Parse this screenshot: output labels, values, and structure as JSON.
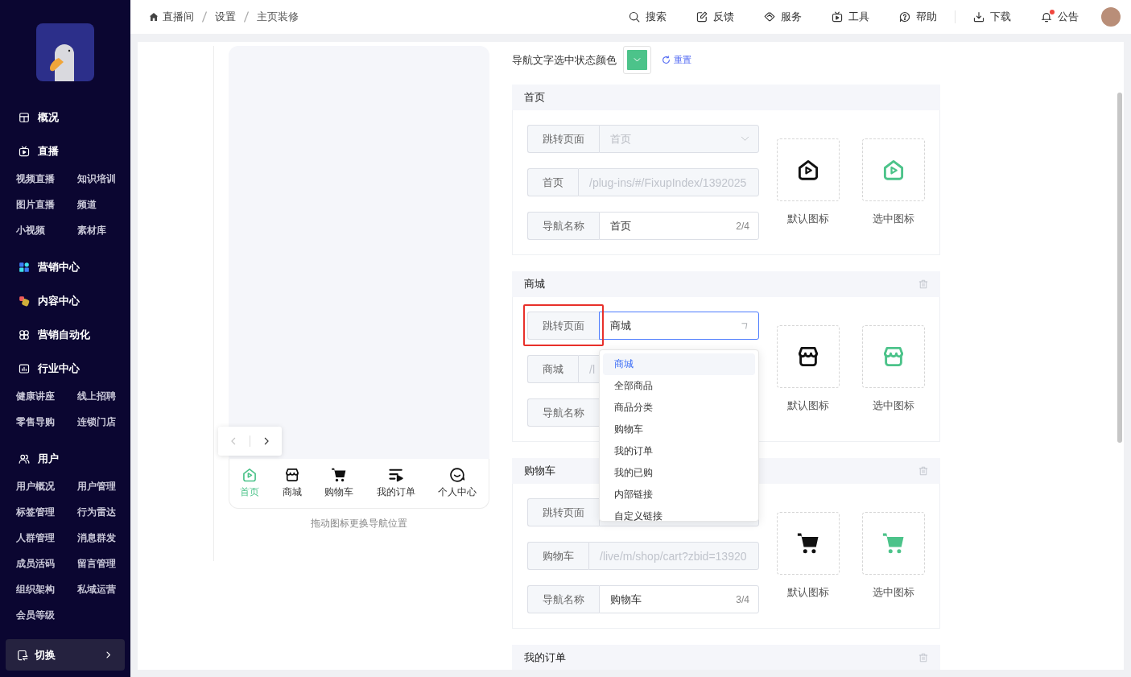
{
  "sidebar": {
    "sections": [
      {
        "label": "概况"
      },
      {
        "label": "直播",
        "items": [
          "视频直播",
          "知识培训",
          "图片直播",
          "频道",
          "小视频",
          "素材库"
        ]
      },
      {
        "label": "营销中心"
      },
      {
        "label": "内容中心"
      },
      {
        "label": "营销自动化"
      },
      {
        "label": "行业中心",
        "items": [
          "健康讲座",
          "线上招聘",
          "零售导购",
          "连锁门店"
        ]
      },
      {
        "label": "用户",
        "items": [
          "用户概况",
          "用户管理",
          "标签管理",
          "行为雷达",
          "人群管理",
          "消息群发",
          "成员活码",
          "留言管理",
          "组织架构",
          "私域运营",
          "会员等级"
        ]
      }
    ],
    "switch_button": {
      "label": "切换"
    }
  },
  "topbar": {
    "breadcrumb": [
      "直播间",
      "设置",
      "主页装修"
    ],
    "action_groups": [
      {
        "actions": [
          {
            "label": "搜索",
            "badge": false
          },
          {
            "label": "反馈",
            "badge": false
          },
          {
            "label": "服务",
            "badge": false
          },
          {
            "label": "工具",
            "badge": false
          },
          {
            "label": "帮助",
            "badge": false
          }
        ]
      },
      {
        "actions": [
          {
            "label": "下载",
            "badge": false
          },
          {
            "label": "公告",
            "badge": true
          }
        ]
      }
    ]
  },
  "preview": {
    "nav_items": [
      {
        "label": "首页",
        "selected": true
      },
      {
        "label": "商城",
        "selected": false
      },
      {
        "label": "购物车",
        "selected": false
      },
      {
        "label": "我的订单",
        "selected": false
      },
      {
        "label": "个人中心",
        "selected": false
      }
    ],
    "pager": {
      "prev_disabled": true
    },
    "hint": "拖动图标更换导航位置"
  },
  "form": {
    "color_setting": {
      "label": "导航文字选中状态颜色",
      "color": "#4cc38a",
      "reset": "重置"
    },
    "sections": [
      {
        "title": "首页",
        "deletable": false,
        "fields": [
          {
            "kind": "select",
            "label": "跳转页面",
            "value": "首页",
            "disabled": true,
            "focused": false,
            "highlighted": false,
            "open": false
          },
          {
            "kind": "link",
            "label": "首页",
            "value": "/plug-ins/#/FixupIndex/1392025"
          },
          {
            "kind": "text",
            "label": "导航名称",
            "value": "首页",
            "count": "2/4"
          }
        ],
        "icons": [
          {
            "label": "默认图标",
            "kind": "default"
          },
          {
            "label": "选中图标",
            "kind": "active"
          }
        ]
      },
      {
        "title": "商城",
        "deletable": true,
        "fields": [
          {
            "kind": "select",
            "label": "跳转页面",
            "value": "商城",
            "disabled": false,
            "focused": true,
            "highlighted": true,
            "open": true,
            "options": [
              {
                "label": "商城",
                "selected": true
              },
              {
                "label": "全部商品",
                "selected": false
              },
              {
                "label": "商品分类",
                "selected": false
              },
              {
                "label": "购物车",
                "selected": false
              },
              {
                "label": "我的订单",
                "selected": false
              },
              {
                "label": "我的已购",
                "selected": false
              },
              {
                "label": "内部链接",
                "selected": false
              },
              {
                "label": "自定义链接",
                "selected": false
              }
            ]
          },
          {
            "kind": "link",
            "label": "商城",
            "value": "/l"
          },
          {
            "kind": "text",
            "label": "导航名称"
          }
        ],
        "icons": [
          {
            "label": "默认图标",
            "kind": "default"
          },
          {
            "label": "选中图标",
            "kind": "active"
          }
        ]
      },
      {
        "title": "购物车",
        "deletable": true,
        "fields": [
          {
            "kind": "select",
            "label": "跳转页面",
            "disabled": true,
            "focused": false,
            "highlighted": false
          },
          {
            "kind": "link",
            "label": "购物车",
            "value": "/live/m/shop/cart?zbid=13920"
          },
          {
            "kind": "text",
            "label": "导航名称",
            "value": "购物车",
            "count": "3/4"
          }
        ],
        "icons": [
          {
            "label": "默认图标",
            "kind": "default"
          },
          {
            "label": "选中图标",
            "kind": "active"
          }
        ]
      },
      {
        "title": "我的订单",
        "deletable": true
      }
    ]
  }
}
